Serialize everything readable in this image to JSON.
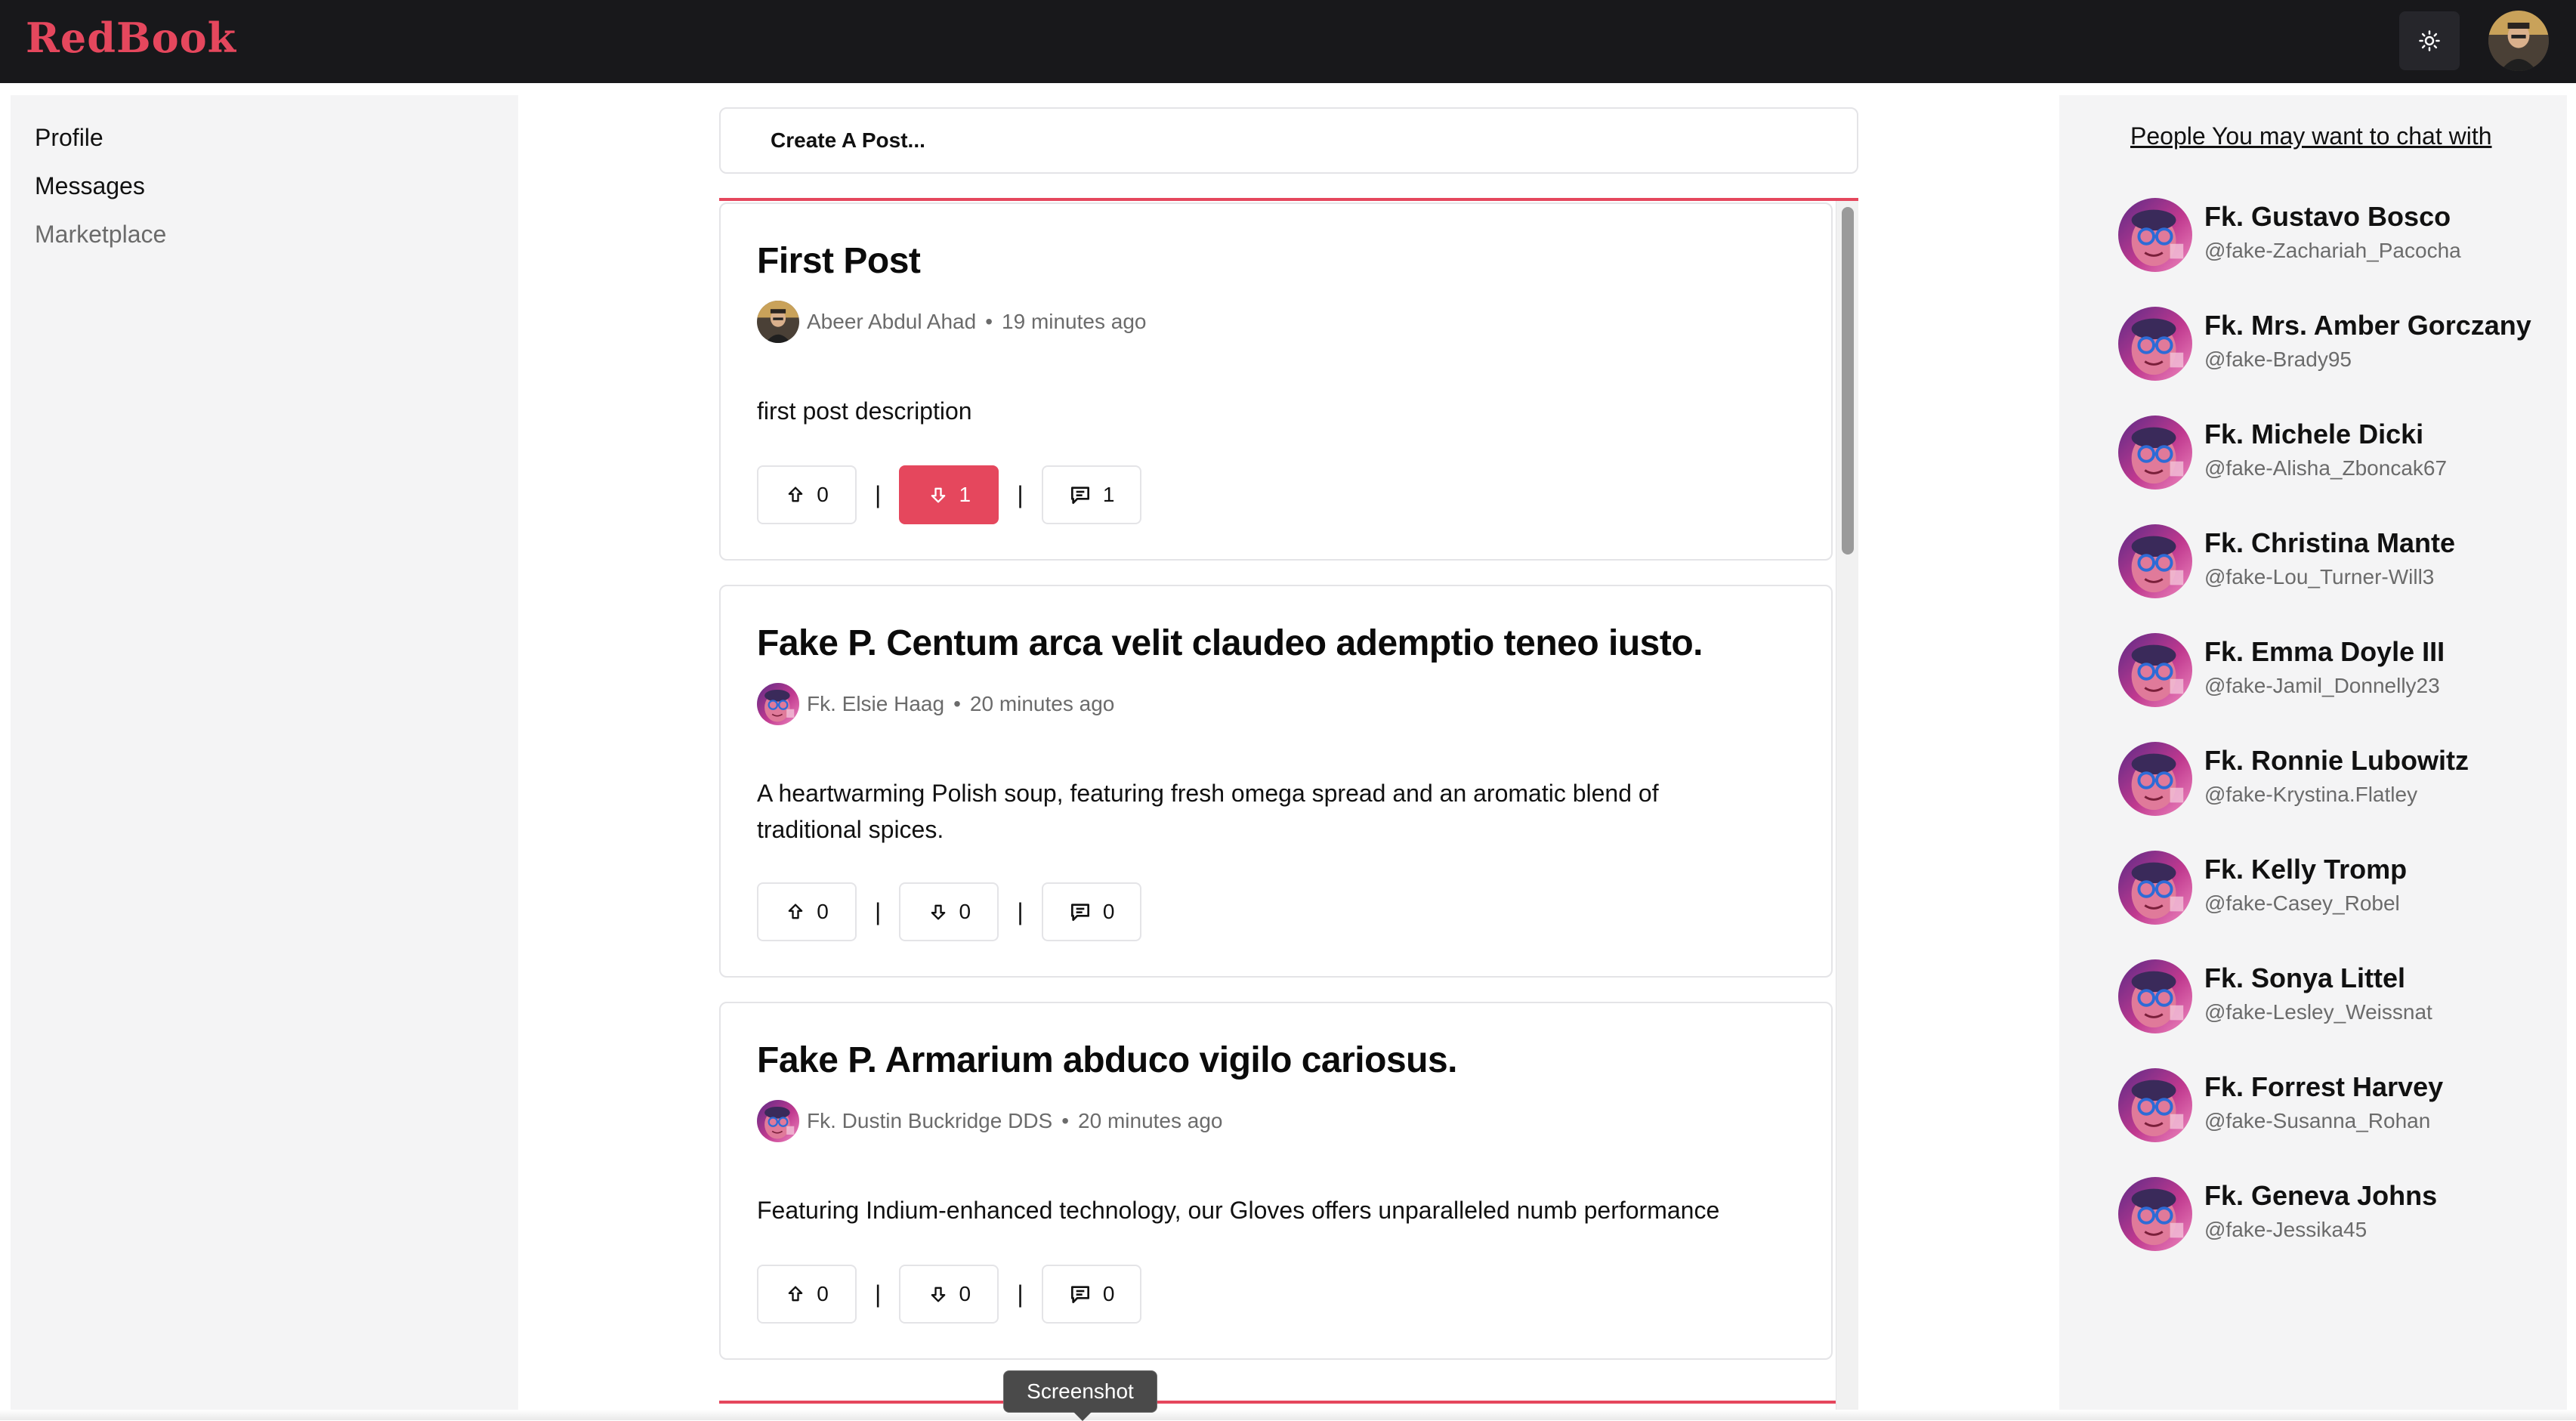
{
  "header": {
    "logo": "RedBook",
    "theme_icon": "sun-icon",
    "accent_color": "#e5475d"
  },
  "sidebar": {
    "items": [
      {
        "label": "Profile"
      },
      {
        "label": "Messages"
      },
      {
        "label": "Marketplace"
      }
    ]
  },
  "feed": {
    "create_post_label": "Create A Post...",
    "posts": [
      {
        "title": "First Post",
        "author": "Abeer Abdul Ahad",
        "time": "19 minutes ago",
        "description": "first post description",
        "upvotes": "0",
        "downvotes": "1",
        "comments": "1",
        "downvoted": true
      },
      {
        "title": "Fake P. Centum arca velit claudeo ademptio teneo iusto.",
        "author": "Fk. Elsie Haag",
        "time": "20 minutes ago",
        "description": "A heartwarming Polish soup, featuring fresh omega spread and an aromatic blend of traditional spices.",
        "upvotes": "0",
        "downvotes": "0",
        "comments": "0",
        "downvoted": false
      },
      {
        "title": "Fake P. Armarium abduco vigilo cariosus.",
        "author": "Fk. Dustin Buckridge DDS",
        "time": "20 minutes ago",
        "description": "Featuring Indium-enhanced technology, our Gloves offers unparalleled numb performance",
        "upvotes": "0",
        "downvotes": "0",
        "comments": "0",
        "downvoted": false
      }
    ]
  },
  "chat_suggestions": {
    "heading": "People You may want to chat with",
    "people": [
      {
        "name": "Fk. Gustavo Bosco",
        "handle": "@fake-Zachariah_Pacocha"
      },
      {
        "name": "Fk. Mrs. Amber Gorczany",
        "handle": "@fake-Brady95"
      },
      {
        "name": "Fk. Michele Dicki",
        "handle": "@fake-Alisha_Zboncak67"
      },
      {
        "name": "Fk. Christina Mante",
        "handle": "@fake-Lou_Turner-Will3"
      },
      {
        "name": "Fk. Emma Doyle III",
        "handle": "@fake-Jamil_Donnelly23"
      },
      {
        "name": "Fk. Ronnie Lubowitz",
        "handle": "@fake-Krystina.Flatley"
      },
      {
        "name": "Fk. Kelly Tromp",
        "handle": "@fake-Casey_Robel"
      },
      {
        "name": "Fk. Sonya Littel",
        "handle": "@fake-Lesley_Weissnat"
      },
      {
        "name": "Fk. Forrest Harvey",
        "handle": "@fake-Susanna_Rohan"
      },
      {
        "name": "Fk. Geneva Johns",
        "handle": "@fake-Jessika45"
      }
    ]
  },
  "tooltip": {
    "text": "Screenshot"
  }
}
